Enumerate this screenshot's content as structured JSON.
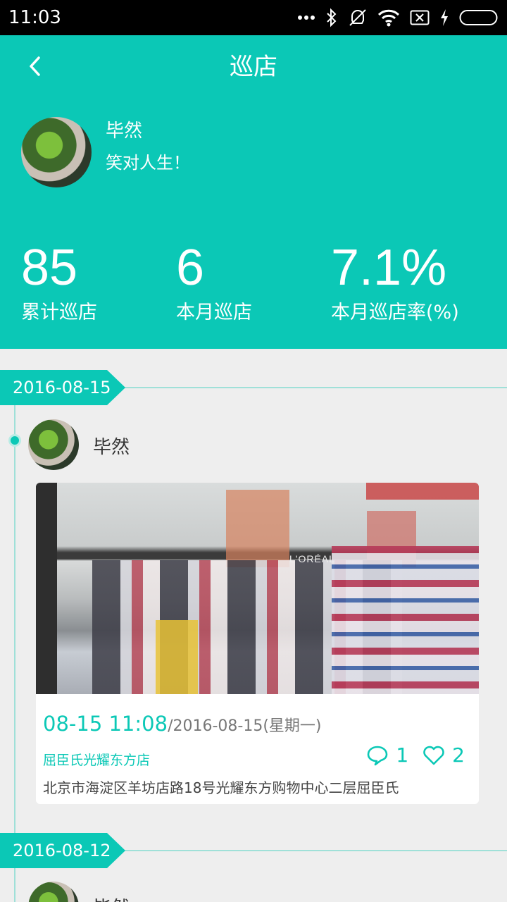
{
  "status_bar": {
    "time": "11:03",
    "icons": [
      "more-dots-icon",
      "bluetooth-icon",
      "vibrate-off-icon",
      "wifi-icon",
      "no-sim-icon",
      "charging-icon",
      "battery-icon"
    ]
  },
  "header": {
    "title": "巡店",
    "back_icon": "chevron-left-icon",
    "user": {
      "name": "毕然",
      "motto": "笑对人生！"
    },
    "stats": [
      {
        "value": "85",
        "label": "累计巡店"
      },
      {
        "value": "6",
        "label": "本月巡店"
      },
      {
        "value": "7.1%",
        "label": "本月巡店率(%)"
      }
    ]
  },
  "timeline": [
    {
      "date": "2016-08-15",
      "poster": "毕然",
      "photo": {
        "sign_text": "L'ORÉAL"
      },
      "time": "08-15 11:08",
      "date_detail": "/2016-08-15(星期一)",
      "store": "屈臣氏光耀东方店",
      "address": "北京市海淀区羊坊店路18号光耀东方购物中心二层屈臣氏",
      "comments": "1",
      "likes": "2"
    },
    {
      "date": "2016-08-12",
      "poster": "毕然"
    }
  ],
  "colors": {
    "accent": "#0bc8b6",
    "background": "#eeeeee"
  }
}
